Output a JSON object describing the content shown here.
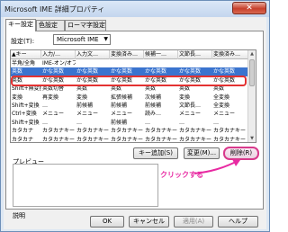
{
  "window": {
    "title": "Microsoft IME 詳細プロパティ",
    "close_label": "✕"
  },
  "tabs": [
    {
      "label": "キー設定",
      "active": true
    },
    {
      "label": "色設定",
      "active": false
    },
    {
      "label": "ローマ字設定",
      "active": false
    }
  ],
  "setting": {
    "label": "設定(T):",
    "value": "Microsoft IME"
  },
  "table": {
    "headers": [
      "キー",
      "入力/…",
      "入力文…",
      "変換済み…",
      "候補一…",
      "文節長…",
      "変換済み…"
    ],
    "rows": [
      [
        "半角/全角",
        "IME-オン/オフ",
        "",
        "",
        "",
        "",
        ""
      ],
      [
        "英数",
        "かな英数",
        "かな英数",
        "かな英数",
        "かな英数",
        "かな英数",
        "かな英数"
      ],
      [
        "英数",
        "かな英数",
        "かな英数",
        "かな英数",
        "かな英数",
        "かな英数",
        "かな英数"
      ],
      [
        "Shift+無変換",
        "英数切替",
        "英数",
        "英数",
        "英数",
        "英数",
        "英数"
      ],
      [
        "変換",
        "再変換",
        "変換",
        "拡張候補",
        "次候補",
        "変換",
        "全変換"
      ],
      [
        "Shift+変換",
        "…",
        "前候補",
        "前候補",
        "前候補",
        "文節長…",
        "全変換"
      ],
      [
        "Ctrl+変換",
        "メニュー",
        "メニュー",
        "メニュー",
        "読み…",
        "メニュー",
        "メニュー"
      ],
      [
        "Shift+変換",
        "…",
        "…",
        "前候補",
        "…",
        "…",
        "…"
      ],
      [
        "カタカナ",
        "カタカナキー",
        "カタカナキー",
        "カタカナキー",
        "カタカナキー",
        "カタカナキー",
        "カタカナキー"
      ],
      [
        "カタカナ",
        "カタカナキー",
        "カタカナキー",
        "カタカナキー",
        "カタカナキー",
        "カタカナキー",
        "カタカナキー"
      ]
    ],
    "selected_row": 1
  },
  "buttons": {
    "add": "キー追加(S)",
    "change": "変更(M)...",
    "delete": "削除(R)",
    "ok": "OK",
    "cancel": "キャンセル",
    "apply": "適用(A)",
    "help": "ヘルプ"
  },
  "preview": {
    "label": "プレビュー"
  },
  "explain": {
    "label": "説明"
  },
  "annotation": {
    "text": "クリックする",
    "color": "#e82aa2",
    "highlight_color": "#e33232"
  }
}
